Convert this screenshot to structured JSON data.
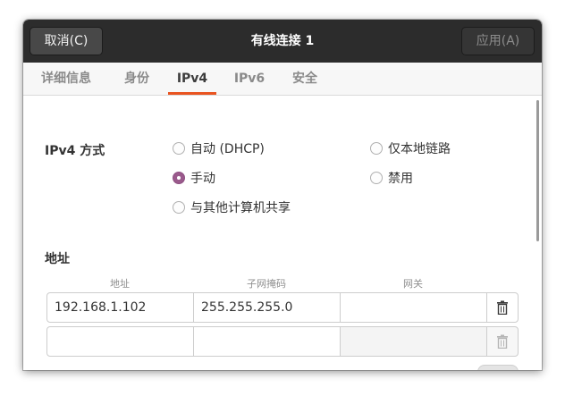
{
  "titlebar": {
    "cancel_label": "取消(C)",
    "title": "有线连接 1",
    "apply_label": "应用(A)"
  },
  "tabs": [
    {
      "label": "详细信息",
      "active": false
    },
    {
      "label": "身份",
      "active": false
    },
    {
      "label": "IPv4",
      "active": true
    },
    {
      "label": "IPv6",
      "active": false
    },
    {
      "label": "安全",
      "active": false
    }
  ],
  "ipv4": {
    "method_label": "IPv4 方式",
    "methods": [
      {
        "label": "自动 (DHCP)",
        "checked": false
      },
      {
        "label": "仅本地链路",
        "checked": false
      },
      {
        "label": "手动",
        "checked": true
      },
      {
        "label": "禁用",
        "checked": false
      },
      {
        "label": "与其他计算机共享",
        "checked": false
      }
    ]
  },
  "addresses": {
    "section_label": "地址",
    "columns": [
      "地址",
      "子网掩码",
      "网关"
    ],
    "rows": [
      {
        "address": "192.168.1.102",
        "netmask": "255.255.255.0",
        "gateway": ""
      },
      {
        "address": "",
        "netmask": "",
        "gateway": ""
      }
    ]
  },
  "colors": {
    "accent": "#e95420",
    "radio_checked": "#9a5a8c",
    "titlebar": "#2c2c2c"
  },
  "icons": {
    "delete": "trash-icon"
  }
}
